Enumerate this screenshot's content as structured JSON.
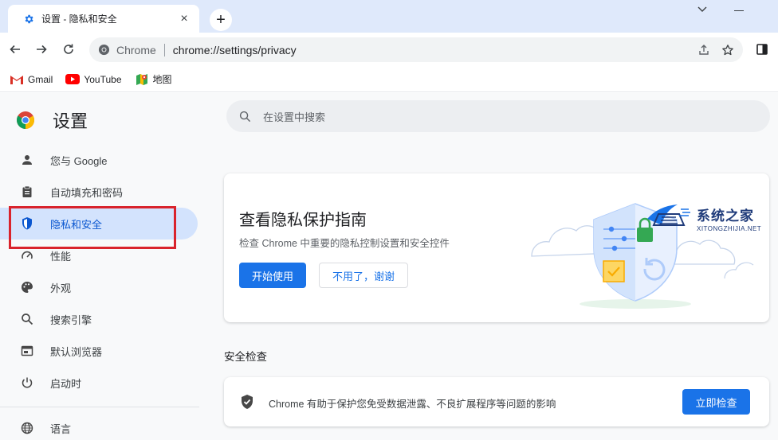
{
  "browser": {
    "tab_title": "设置 - 隐私和安全",
    "tab_close": "×",
    "new_tab": "+",
    "site_name": "Chrome",
    "url": "chrome://settings/privacy"
  },
  "bookmarks": [
    {
      "label": "Gmail",
      "icon": "gmail-icon"
    },
    {
      "label": "YouTube",
      "icon": "youtube-icon"
    },
    {
      "label": "地图",
      "icon": "maps-icon"
    }
  ],
  "settings": {
    "title": "设置",
    "search_placeholder": "在设置中搜索",
    "nav": [
      {
        "label": "您与 Google",
        "icon": "person-icon"
      },
      {
        "label": "自动填充和密码",
        "icon": "clipboard-icon"
      },
      {
        "label": "隐私和安全",
        "icon": "shield-icon",
        "active": true
      },
      {
        "label": "性能",
        "icon": "speedometer-icon"
      },
      {
        "label": "外观",
        "icon": "palette-icon"
      },
      {
        "label": "搜索引擎",
        "icon": "search-icon"
      },
      {
        "label": "默认浏览器",
        "icon": "browser-window-icon"
      },
      {
        "label": "启动时",
        "icon": "power-icon"
      },
      {
        "label": "语言",
        "icon": "globe-icon"
      }
    ]
  },
  "privacy_guide": {
    "title": "查看隐私保护指南",
    "description": "检查 Chrome 中重要的隐私控制设置和安全控件",
    "start_button": "开始使用",
    "dismiss_button": "不用了，谢谢"
  },
  "safety_check": {
    "section_title": "安全检查",
    "description": "Chrome 有助于保护您免受数据泄露、不良扩展程序等问题的影响",
    "check_button": "立即检查"
  },
  "watermark": {
    "name": "系统之家",
    "url": "XITONGZHIJIA.NET"
  },
  "colors": {
    "accent": "#1a73e8",
    "active_nav_bg": "#d3e3fd",
    "highlight_border": "#d9232c",
    "tabstrip_bg": "#dfe9fb"
  }
}
